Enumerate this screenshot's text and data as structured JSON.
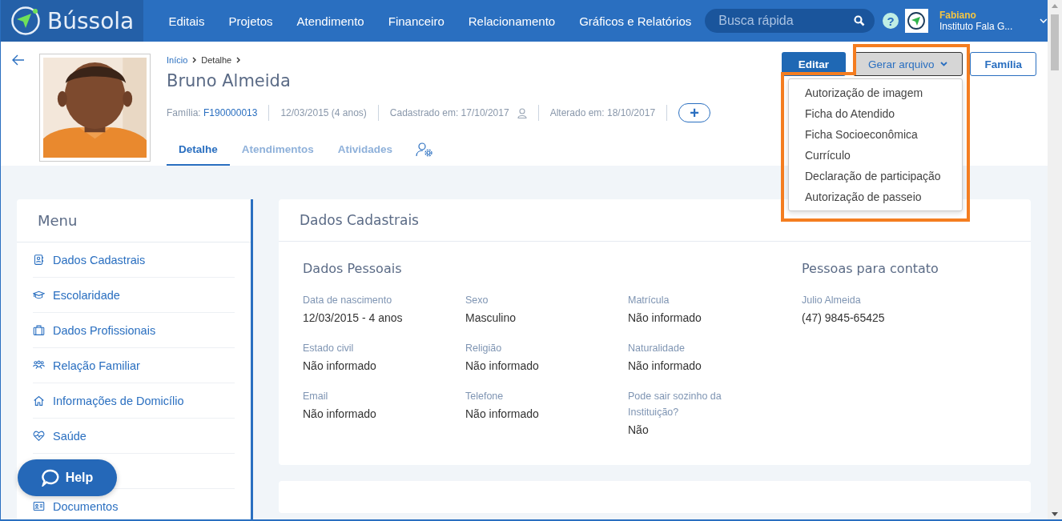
{
  "app": {
    "logo": "Bússola"
  },
  "nav": [
    "Editais",
    "Projetos",
    "Atendimento",
    "Financeiro",
    "Relacionamento",
    "Gráficos e Relatórios"
  ],
  "search": {
    "placeholder": "Busca rápida"
  },
  "help_icon": "?",
  "user": {
    "name": "Fabiano",
    "org": "Instituto Fala G..."
  },
  "breadcrumb": [
    {
      "label": "Início",
      "link": true
    },
    {
      "label": "Detalhe",
      "link": false
    }
  ],
  "person": {
    "name": "Bruno Almeida"
  },
  "meta": [
    {
      "kind": "link",
      "label": "Família:",
      "value": "F190000013"
    },
    {
      "kind": "text",
      "text": "12/03/2015 (4 anos)"
    },
    {
      "kind": "user",
      "text": "Cadastrado em: 17/10/2017"
    },
    {
      "kind": "text",
      "text": "Alterado em: 18/10/2017"
    }
  ],
  "add_button": "+",
  "tabs": [
    {
      "label": "Detalhe",
      "selected": true
    },
    {
      "label": "Atendimentos",
      "selected": false
    },
    {
      "label": "Atividades",
      "selected": false
    }
  ],
  "actions": [
    {
      "kind": "primary",
      "label": "Editar"
    },
    {
      "kind": "dropdown",
      "label": "Gerar arquivo",
      "expanded": true
    },
    {
      "kind": "outline",
      "label": "Família"
    }
  ],
  "file_menu": [
    "Autorização de imagem",
    "Ficha do Atendido",
    "Ficha Socioeconômica",
    "Currículo",
    "Declaração de participação",
    "Autorização de passeio"
  ],
  "sidebar": {
    "title": "Menu",
    "items": [
      {
        "kind": "id-card",
        "label": "Dados Cadastrais"
      },
      {
        "kind": "graduation",
        "label": "Escolaridade"
      },
      {
        "kind": "briefcase",
        "label": "Dados Profissionais"
      },
      {
        "kind": "people",
        "label": "Relação Familiar"
      },
      {
        "kind": "home",
        "label": "Informações de Domicílio"
      },
      {
        "kind": "heart",
        "label": "Saúde"
      },
      {
        "kind": "document",
        "label": "Documentos"
      }
    ]
  },
  "help_button": {
    "label": "Help"
  },
  "card": {
    "title": "Dados Cadastrais",
    "section": "Dados Pessoais",
    "fields": [
      {
        "label": "Data de nascimento",
        "value": "12/03/2015 - 4 anos"
      },
      {
        "label": "Sexo",
        "value": "Masculino"
      },
      {
        "label": "Matrícula",
        "value": "Não informado"
      },
      {
        "label": "Estado civil",
        "value": "Não informado"
      },
      {
        "label": "Religião",
        "value": "Não informado"
      },
      {
        "label": "Naturalidade",
        "value": "Não informado"
      },
      {
        "label": "Email",
        "value": "Não informado"
      },
      {
        "label": "Telefone",
        "value": "Não informado"
      },
      {
        "label": "Pode sair sozinho da Instituição?",
        "value": "Não"
      }
    ],
    "contacts": {
      "title": "Pessoas para contato",
      "items": [
        {
          "name": "Julio Almeida",
          "phone": "(47) 9845-65425"
        }
      ]
    }
  }
}
